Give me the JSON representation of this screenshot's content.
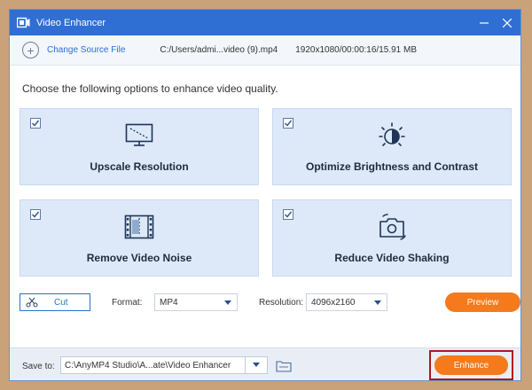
{
  "window": {
    "title": "Video Enhancer"
  },
  "source": {
    "change_label": "Change Source File",
    "path": "C:/Users/admi...video (9).mp4",
    "info": "1920x1080/00:00:16/15.91 MB"
  },
  "instruction": "Choose the following options to enhance video quality.",
  "options": [
    {
      "label": "Upscale Resolution",
      "checked": true,
      "icon": "upscale-monitor-icon"
    },
    {
      "label": "Optimize Brightness and Contrast",
      "checked": true,
      "icon": "brightness-icon"
    },
    {
      "label": "Remove Video Noise",
      "checked": true,
      "icon": "film-noise-icon"
    },
    {
      "label": "Reduce Video Shaking",
      "checked": true,
      "icon": "camera-shake-icon"
    }
  ],
  "controls": {
    "cut_label": "Cut",
    "format_label": "Format:",
    "format_value": "MP4",
    "resolution_label": "Resolution:",
    "resolution_value": "4096x2160",
    "preview_label": "Preview"
  },
  "footer": {
    "save_label": "Save to:",
    "save_path": "C:\\AnyMP4 Studio\\A...ate\\Video Enhancer",
    "enhance_label": "Enhance"
  },
  "colors": {
    "titlebar": "#2f6fd3",
    "accent_orange": "#f47a1c",
    "card_bg": "#dde9f8",
    "highlight_border": "#b3151d"
  }
}
